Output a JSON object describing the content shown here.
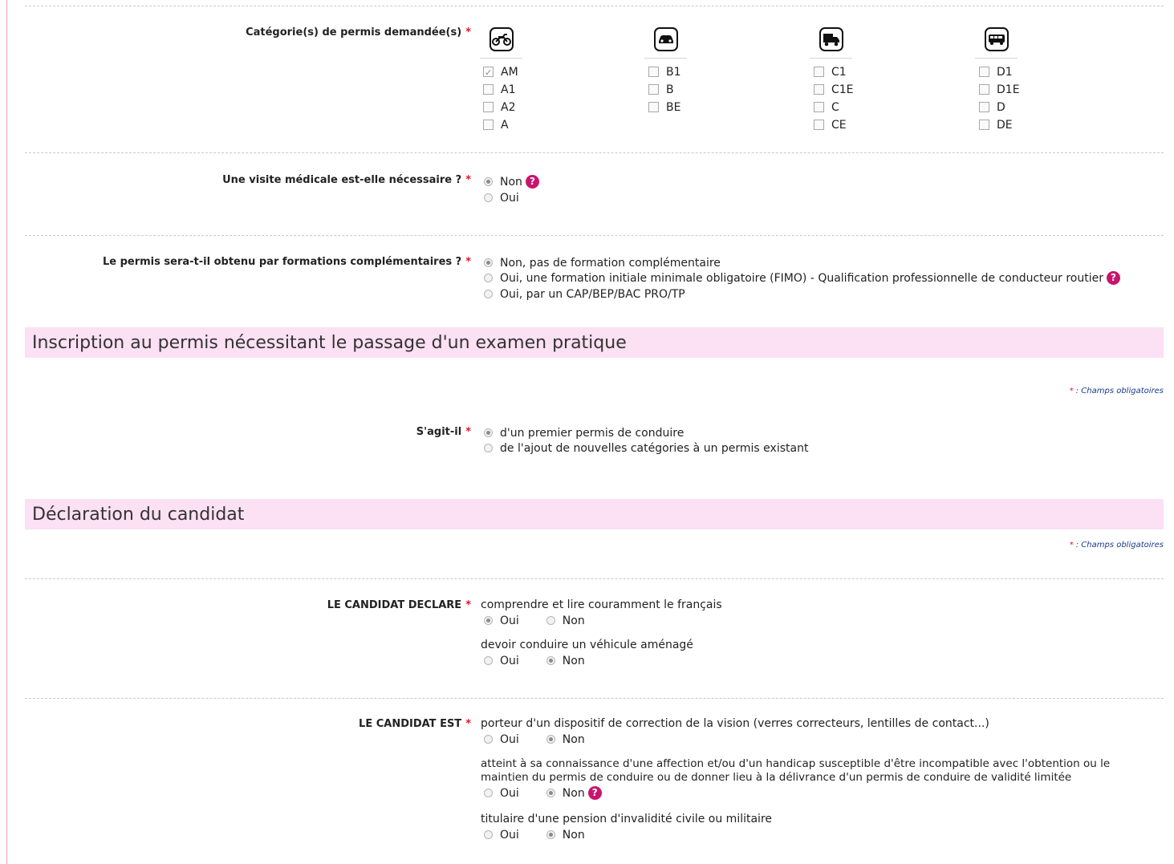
{
  "categories": {
    "label": "Catégorie(s) de permis demandée(s)",
    "groups": [
      {
        "icon": "motorcycle-icon",
        "options": [
          {
            "code": "AM",
            "checked": true
          },
          {
            "code": "A1",
            "checked": false
          },
          {
            "code": "A2",
            "checked": false
          },
          {
            "code": "A",
            "checked": false
          }
        ]
      },
      {
        "icon": "car-icon",
        "options": [
          {
            "code": "B1",
            "checked": false
          },
          {
            "code": "B",
            "checked": false
          },
          {
            "code": "BE",
            "checked": false
          }
        ]
      },
      {
        "icon": "truck-icon",
        "options": [
          {
            "code": "C1",
            "checked": false
          },
          {
            "code": "C1E",
            "checked": false
          },
          {
            "code": "C",
            "checked": false
          },
          {
            "code": "CE",
            "checked": false
          }
        ]
      },
      {
        "icon": "bus-icon",
        "options": [
          {
            "code": "D1",
            "checked": false
          },
          {
            "code": "D1E",
            "checked": false
          },
          {
            "code": "D",
            "checked": false
          },
          {
            "code": "DE",
            "checked": false
          }
        ]
      }
    ]
  },
  "required_star": "*",
  "help_glyph": "?",
  "medical": {
    "label": "Une visite médicale est-elle nécessaire ?",
    "options": [
      "Non",
      "Oui"
    ],
    "selected": "Non"
  },
  "training": {
    "label": "Le permis sera-t-il obtenu par formations complémentaires ?",
    "options": [
      "Non, pas de formation complémentaire",
      "Oui, une formation initiale minimale obligatoire (FIMO) - Qualification professionnelle de conducteur routier",
      "Oui, par un CAP/BEP/BAC PRO/TP"
    ],
    "selected": 0
  },
  "section_exam": {
    "title": "Inscription au permis nécessitant le passage d'un examen pratique",
    "mandatory_star": "*",
    "mandatory_note": ": Champs obligatoires"
  },
  "sagit": {
    "label": "S'agit-il",
    "options": [
      "d'un premier permis de conduire",
      "de l'ajout de nouvelles catégories à un permis existant"
    ],
    "selected": 0
  },
  "section_declaration": {
    "title": "Déclaration du candidat",
    "mandatory_star": "*",
    "mandatory_note": ": Champs obligatoires"
  },
  "declare": {
    "label": "LE CANDIDAT DECLARE",
    "questions": [
      {
        "text": "comprendre et lire couramment le français",
        "yes": "Oui",
        "no": "Non",
        "selected": "Oui"
      },
      {
        "text": "devoir conduire un véhicule aménagé",
        "yes": "Oui",
        "no": "Non",
        "selected": "Non"
      }
    ]
  },
  "est": {
    "label": "LE CANDIDAT EST",
    "questions": [
      {
        "text": "porteur d'un dispositif de correction de la vision (verres correcteurs, lentilles de contact...)",
        "yes": "Oui",
        "no": "Non",
        "selected": "Non"
      },
      {
        "text_line1": "atteint à sa connaissance d'une affection et/ou d'un handicap susceptible d'être incompatible avec l'obtention ou le",
        "text_line2": "maintien du permis de conduire ou de donner lieu à la délivrance d'un permis de conduire de validité limitée",
        "yes": "Oui",
        "no": "Non",
        "selected": "Non"
      },
      {
        "text": "titulaire d'une pension d'invalidité civile ou militaire",
        "yes": "Oui",
        "no": "Non",
        "selected": "Non"
      }
    ]
  },
  "colors": {
    "section_bg": "#fce0f3",
    "required": "#e0142f",
    "help": "#c8146e",
    "note": "#1a3b8a"
  }
}
